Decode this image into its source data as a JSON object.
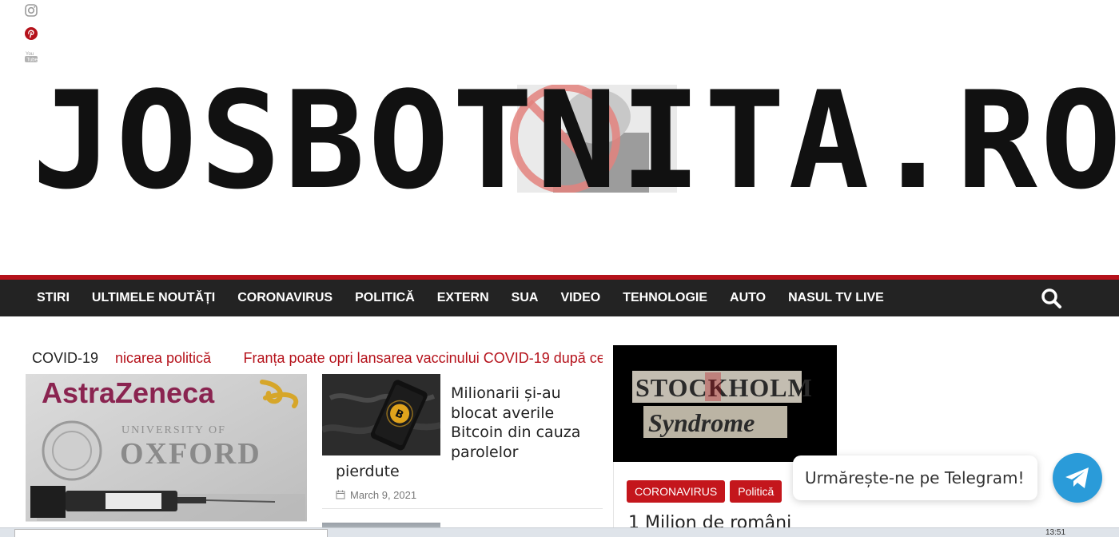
{
  "social": {
    "icons": [
      "instagram-icon",
      "pinterest-icon",
      "youtube-icon"
    ],
    "pinterest_color": "#b5121b",
    "muted_color": "#9a9a9a"
  },
  "logo": {
    "text": "JOSBOTNITA.RO"
  },
  "nav": {
    "items": [
      "STIRI",
      "ULTIMELE NOUTĂȚI",
      "CORONAVIRUS",
      "POLITICĂ",
      "EXTERN",
      "SUA",
      "VIDEO",
      "TEHNOLOGIE",
      "AUTO",
      "NASUL TV LIVE"
    ],
    "search_icon": "search-icon",
    "background": "#232323",
    "accent": "#b5121b"
  },
  "ticker": {
    "label": "COVID-19",
    "items": [
      "nicarea politică",
      "Franța poate opri lansarea vaccinului COVID-19 după ce"
    ]
  },
  "featured": {
    "image": {
      "brand": "AstraZeneca",
      "institution_top": "UNIVERSITY OF",
      "institution": "OXFORD"
    }
  },
  "article2": {
    "title_main": "Milionarii și-au blocat averile Bitcoin din cauza parolelor",
    "title_tail": "pierdute",
    "date": "March 9, 2021"
  },
  "sidebar": {
    "image_text_line1": "STOCKHOLM",
    "image_text_line2": "Syndrome",
    "categories": [
      "CORONAVIRUS",
      "Politică"
    ],
    "title": "1 Milion de români"
  },
  "telegram": {
    "cta": "Urmărește-ne pe Telegram!",
    "icon": "telegram-icon",
    "color": "#2a9bd9"
  },
  "taskbar": {
    "clock": "13:51"
  }
}
